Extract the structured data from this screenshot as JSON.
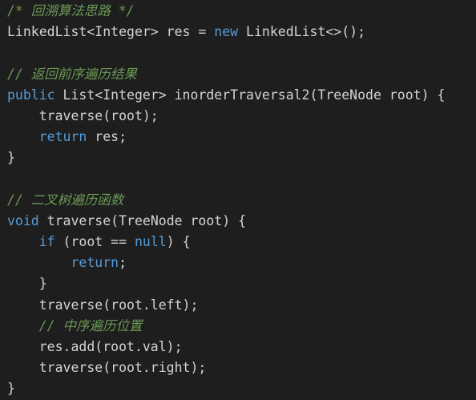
{
  "editor": {
    "colors": {
      "background": "#1e1e1e",
      "plain": "#d4d4d4",
      "keyword": "#569cd6",
      "comment": "#6a9955"
    },
    "lines": [
      [
        {
          "t": "comment",
          "v": "/* 回溯算法思路 */"
        }
      ],
      [
        {
          "t": "plain",
          "v": "LinkedList<Integer> res = "
        },
        {
          "t": "keyword",
          "v": "new"
        },
        {
          "t": "plain",
          "v": " LinkedList<>();"
        }
      ],
      [],
      [
        {
          "t": "comment",
          "v": "// 返回前序遍历结果"
        }
      ],
      [
        {
          "t": "keyword",
          "v": "public"
        },
        {
          "t": "plain",
          "v": " List<Integer> inorderTraversal2(TreeNode root) {"
        }
      ],
      [
        {
          "t": "plain",
          "v": "    traverse(root);"
        }
      ],
      [
        {
          "t": "plain",
          "v": "    "
        },
        {
          "t": "keyword",
          "v": "return"
        },
        {
          "t": "plain",
          "v": " res;"
        }
      ],
      [
        {
          "t": "plain",
          "v": "}"
        }
      ],
      [],
      [
        {
          "t": "comment",
          "v": "// 二叉树遍历函数"
        }
      ],
      [
        {
          "t": "keyword",
          "v": "void"
        },
        {
          "t": "plain",
          "v": " traverse(TreeNode root) {"
        }
      ],
      [
        {
          "t": "plain",
          "v": "    "
        },
        {
          "t": "keyword",
          "v": "if"
        },
        {
          "t": "plain",
          "v": " (root == "
        },
        {
          "t": "keyword",
          "v": "null"
        },
        {
          "t": "plain",
          "v": ") {"
        }
      ],
      [
        {
          "t": "plain",
          "v": "        "
        },
        {
          "t": "keyword",
          "v": "return"
        },
        {
          "t": "plain",
          "v": ";"
        }
      ],
      [
        {
          "t": "plain",
          "v": "    }"
        }
      ],
      [
        {
          "t": "plain",
          "v": "    traverse(root.left);"
        }
      ],
      [
        {
          "t": "plain",
          "v": "    "
        },
        {
          "t": "comment",
          "v": "// 中序遍历位置"
        }
      ],
      [
        {
          "t": "plain",
          "v": "    res.add(root.val);"
        }
      ],
      [
        {
          "t": "plain",
          "v": "    traverse(root.right);"
        }
      ],
      [
        {
          "t": "plain",
          "v": "}"
        }
      ]
    ]
  }
}
